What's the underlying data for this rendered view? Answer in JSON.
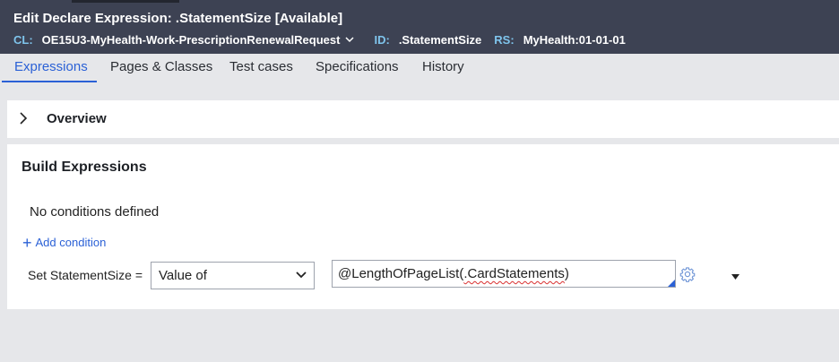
{
  "header": {
    "title": "Edit  Declare Expression: .StatementSize [Available]",
    "cl_label": "CL:",
    "cl_value": "OE15U3-MyHealth-Work-PrescriptionRenewalRequest",
    "id_label": "ID:",
    "id_value": ".StatementSize",
    "rs_label": "RS:",
    "rs_value": "MyHealth:01-01-01"
  },
  "tabs": [
    {
      "label": "Expressions",
      "active": true
    },
    {
      "label": "Pages & Classes"
    },
    {
      "label": "Test cases"
    },
    {
      "label": "Specifications"
    },
    {
      "label": "History"
    }
  ],
  "overview": {
    "label": "Overview",
    "icon": "chevron-right-icon"
  },
  "build": {
    "title": "Build Expressions",
    "no_conditions": "No conditions defined",
    "add_condition": "Add condition",
    "set_label": "Set StatementSize =",
    "select_value": "Value of",
    "expression_prefix": "@LengthOfPageList(",
    "expression_misspelled": ".CardStatements",
    "expression_suffix": ")"
  },
  "icons": {
    "gear": "gear-icon",
    "dropdown": "caret-down-icon"
  },
  "colors": {
    "header_bg": "#3d4253",
    "accent": "#2b61d6",
    "meta_key": "#7fc4ec"
  }
}
